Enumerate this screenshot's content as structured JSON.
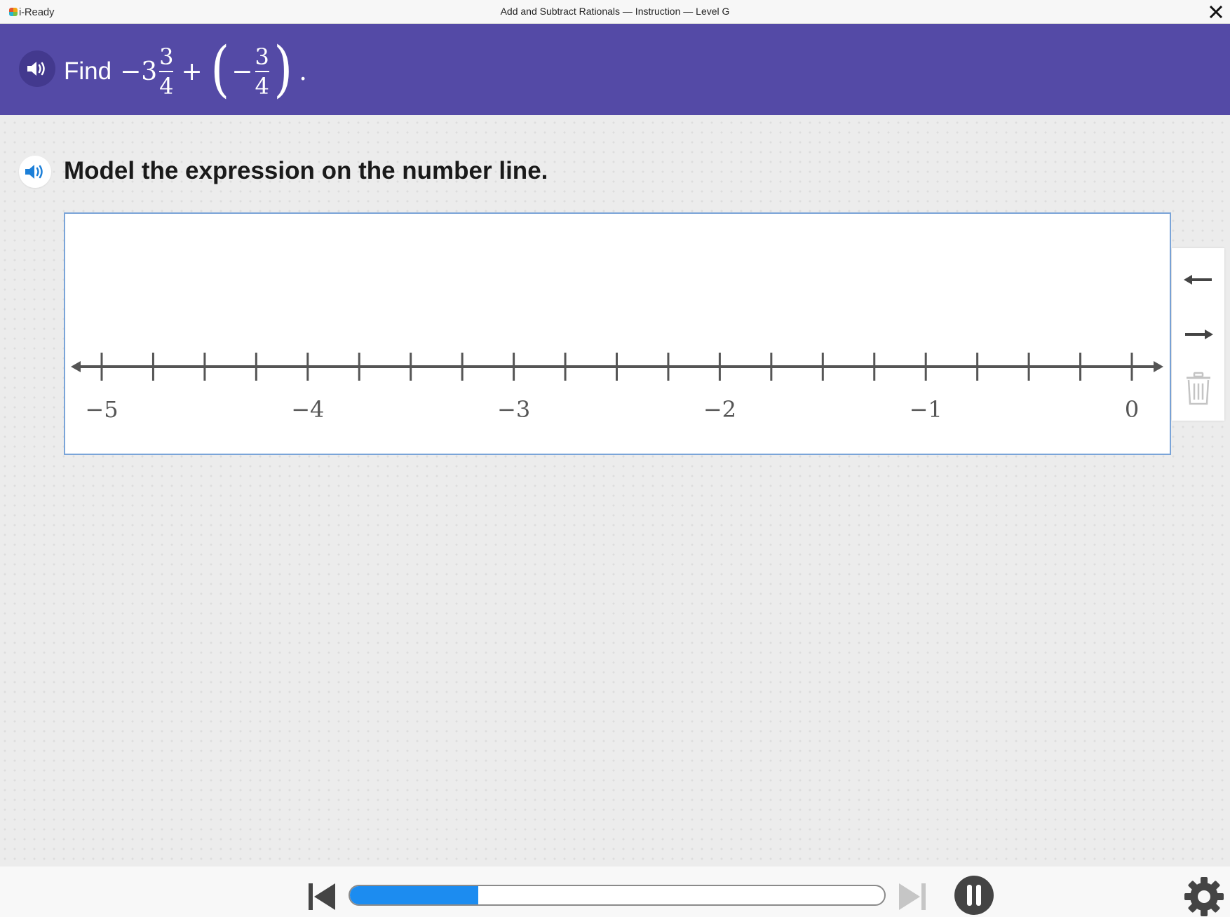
{
  "app": {
    "logo_text": "i-Ready",
    "window_title": "Add and Subtract Rationals — Instruction — Level G"
  },
  "question": {
    "find_word": "Find",
    "whole_sign": "−3",
    "frac1_num": "3",
    "frac1_den": "4",
    "plus": "+",
    "left_paren": "(",
    "neg_sign": "−",
    "frac2_num": "3",
    "frac2_den": "4",
    "right_paren": ")",
    "period": "."
  },
  "instruction": {
    "text": "Model the expression on the number line."
  },
  "number_line": {
    "min": -5,
    "max": 0,
    "ticks_per_unit": 4,
    "labels": [
      "−5",
      "−4",
      "−3",
      "−2",
      "−1",
      "0"
    ]
  },
  "tools": [
    "left-arrow-icon",
    "right-arrow-icon",
    "trash-icon"
  ],
  "progress": {
    "fraction": 0.24
  },
  "colors": {
    "banner": "#544aa6",
    "accent_blue": "#1c8cf0",
    "panel_border": "#7aa4d8"
  }
}
